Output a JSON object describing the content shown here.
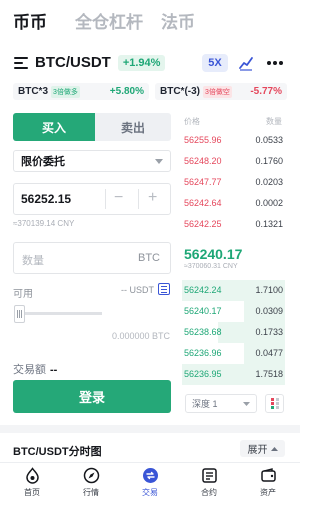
{
  "top_tabs": [
    {
      "label": "币币",
      "active": true
    },
    {
      "label": "全仓杠杆",
      "active": false
    },
    {
      "label": "法币",
      "active": false
    }
  ],
  "header": {
    "pair": "BTC/USDT",
    "change": "+1.94%",
    "leverage": "5X",
    "icons": [
      "menu-icon",
      "kline-chart-icon",
      "more-icon"
    ]
  },
  "etf": [
    {
      "name": "BTC*3",
      "tag": "3倍做多",
      "change": "+5.80%"
    },
    {
      "name": "BTC*(-3)",
      "tag": "3倍做空",
      "change": "-5.77%"
    }
  ],
  "trade": {
    "buy_label": "买入",
    "sell_label": "卖出",
    "order_type": "限价委托",
    "price_value": "56252.15",
    "price_cny": "≈370139.14 CNY",
    "quantity_placeholder": "数量",
    "quantity_unit": "BTC",
    "available_label": "可用",
    "available_value": "-- USDT",
    "slider_value": "0.000000 BTC",
    "slider_percent": 0,
    "amount_label": "交易额",
    "amount_value": "--",
    "submit_label": "登录"
  },
  "orderbook": {
    "price_header": "价格",
    "qty_header": "数量",
    "asks": [
      {
        "price": "56255.96",
        "qty": "0.0533"
      },
      {
        "price": "56248.20",
        "qty": "0.1760"
      },
      {
        "price": "56247.77",
        "qty": "0.0203"
      },
      {
        "price": "56242.64",
        "qty": "0.0002"
      },
      {
        "price": "56242.25",
        "qty": "0.1321"
      }
    ],
    "last_price": "56240.17",
    "last_cny": "≈370060.31 CNY",
    "bids": [
      {
        "price": "56242.24",
        "qty": "1.7100"
      },
      {
        "price": "56240.17",
        "qty": "0.0309"
      },
      {
        "price": "56238.68",
        "qty": "0.1733"
      },
      {
        "price": "56236.96",
        "qty": "0.0477"
      },
      {
        "price": "56236.95",
        "qty": "1.7518"
      }
    ],
    "depth_label": "深度 1"
  },
  "chart_section": {
    "title": "BTC/USDT分时图",
    "expand_label": "展开"
  },
  "bottom_nav": [
    {
      "label": "首页",
      "icon": "home-icon",
      "active": false
    },
    {
      "label": "行情",
      "icon": "market-icon",
      "active": false
    },
    {
      "label": "交易",
      "icon": "trade-icon",
      "active": true
    },
    {
      "label": "合约",
      "icon": "contract-icon",
      "active": false
    },
    {
      "label": "资产",
      "icon": "wallet-icon",
      "active": false
    }
  ],
  "colors": {
    "green": "#25a878",
    "red": "#e5475c",
    "accent": "#3a55d6"
  }
}
